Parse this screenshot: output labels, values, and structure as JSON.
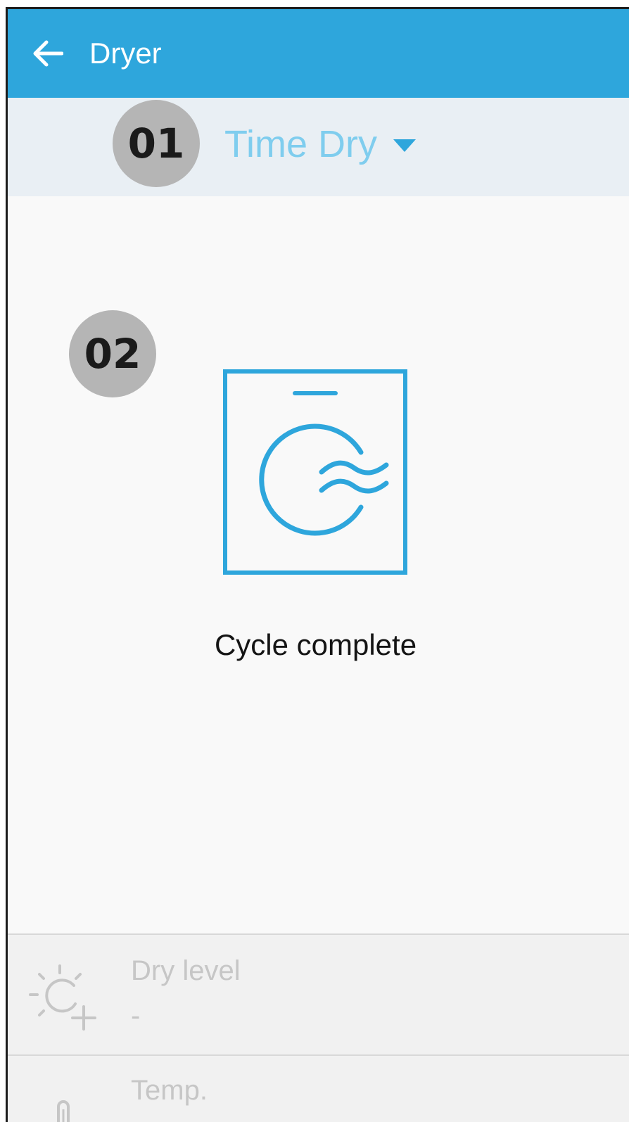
{
  "appbar": {
    "title": "Dryer",
    "back_icon": "arrow-left-icon"
  },
  "mode": {
    "label": "Time Dry",
    "dropdown_icon": "caret-down-icon"
  },
  "callouts": [
    "01",
    "02"
  ],
  "status": {
    "icon": "dryer-icon",
    "text": "Cycle complete"
  },
  "settings": [
    {
      "icon": "dry-level-icon",
      "label": "Dry level",
      "value": "-"
    },
    {
      "icon": "temperature-icon",
      "label": "Temp.",
      "value": ""
    }
  ],
  "colors": {
    "accent": "#2ea6dc",
    "mode_text": "#7fcdee",
    "callout_bg": "#b5b5b5",
    "disabled_text": "#c6c6c6"
  }
}
